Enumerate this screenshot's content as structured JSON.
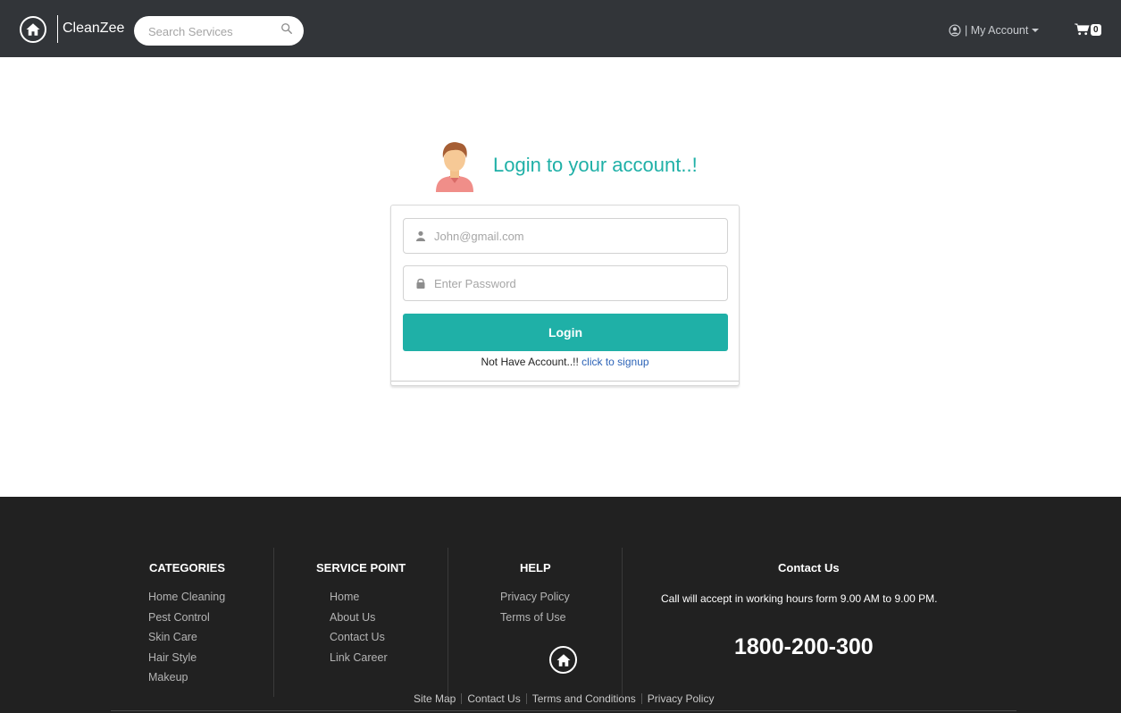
{
  "navbar": {
    "brand": "CleanZee",
    "search_placeholder": "Search Services",
    "account_label": "| My Account",
    "cart_count": "0"
  },
  "login": {
    "title": "Login to your account..!",
    "email_placeholder": "John@gmail.com",
    "password_placeholder": "Enter Password",
    "button_label": "Login",
    "no_account_text": "Not Have Account..!! ",
    "signup_link": "click to signup"
  },
  "footer": {
    "categories": {
      "title": "CATEGORIES",
      "items": [
        "Home Cleaning",
        "Pest Control",
        "Skin Care",
        "Hair Style",
        "Makeup"
      ]
    },
    "service_point": {
      "title": "SERVICE POINT",
      "items": [
        "Home",
        "About Us",
        "Contact Us",
        "Link Career"
      ]
    },
    "help": {
      "title": "HELP",
      "items": [
        "Privacy Policy",
        "Terms of Use"
      ]
    },
    "contact": {
      "title": "Contact Us",
      "note": "Call will accept in working hours form 9.00 AM to 9.00 PM.",
      "phone": "1800-200-300"
    },
    "bottom_links": [
      "Site Map",
      "Contact Us",
      "Terms and Conditions",
      "Privacy Policy"
    ]
  },
  "colors": {
    "navbar_bg": "#323539",
    "accent_teal": "#1fb0a7",
    "link_blue": "#2c63b7",
    "footer_bg": "#212121"
  },
  "icons": [
    "home-icon",
    "search-icon",
    "user-circle-icon",
    "caret-down-icon",
    "cart-icon",
    "user-icon",
    "lock-icon",
    "avatar-icon"
  ]
}
